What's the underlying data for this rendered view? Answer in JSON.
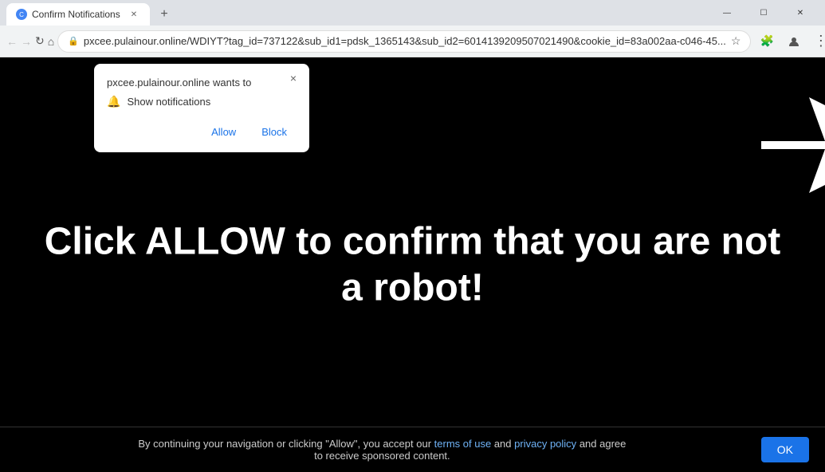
{
  "titleBar": {
    "tab": {
      "title": "Confirm Notifications",
      "favicon": "C"
    },
    "newTabLabel": "+",
    "windowControls": {
      "minimize": "—",
      "maximize": "☐",
      "close": "✕"
    }
  },
  "toolbar": {
    "back": "←",
    "forward": "→",
    "reload": "↻",
    "home": "⌂",
    "url": "pxcee.pulainour.online/WDIYT?tag_id=737122&sub_id1=pdsk_1365143&sub_id2=6014139209507021490&cookie_id=83a002aa-c046-45...",
    "extensions": "🧩",
    "avatar": "👤",
    "menu": "⋮"
  },
  "popup": {
    "site": "pxcee.pulainour.online wants to",
    "permission": "Show notifications",
    "allowLabel": "Allow",
    "blockLabel": "Block",
    "closeLabel": "×"
  },
  "page": {
    "heading": "Click ALLOW to confirm that you are not a robot!",
    "footer": {
      "text1": "By continuing your navigation or clicking \"Allow\", you accept our",
      "termsLabel": "terms of use",
      "text2": "and",
      "privacyLabel": "privacy policy",
      "text3": "and agree",
      "text4": "to receive sponsored content.",
      "okLabel": "OK"
    }
  }
}
